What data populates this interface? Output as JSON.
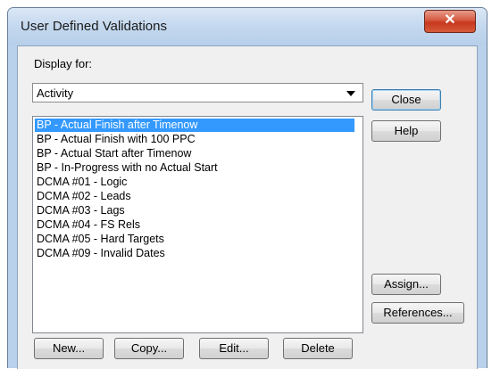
{
  "window": {
    "title": "User Defined Validations"
  },
  "display_for": {
    "label": "Display for:",
    "selected": "Activity"
  },
  "validations": [
    "BP - Actual Finish after Timenow",
    "BP - Actual Finish with 100 PPC",
    "BP - Actual Start after Timenow",
    "BP - In-Progress with no Actual Start",
    "DCMA #01 - Logic",
    "DCMA #02 - Leads",
    "DCMA #03 - Lags",
    "DCMA #04 - FS Rels",
    "DCMA #05 - Hard Targets",
    "DCMA #09 - Invalid Dates"
  ],
  "selected_index": 0,
  "buttons": {
    "close": "Close",
    "help": "Help",
    "assign": "Assign...",
    "references": "References...",
    "new": "New...",
    "copy": "Copy...",
    "edit": "Edit...",
    "delete": "Delete"
  },
  "colors": {
    "selection": "#3399ff",
    "window_close": "#c7381f",
    "frame": "#b9d1ea"
  }
}
